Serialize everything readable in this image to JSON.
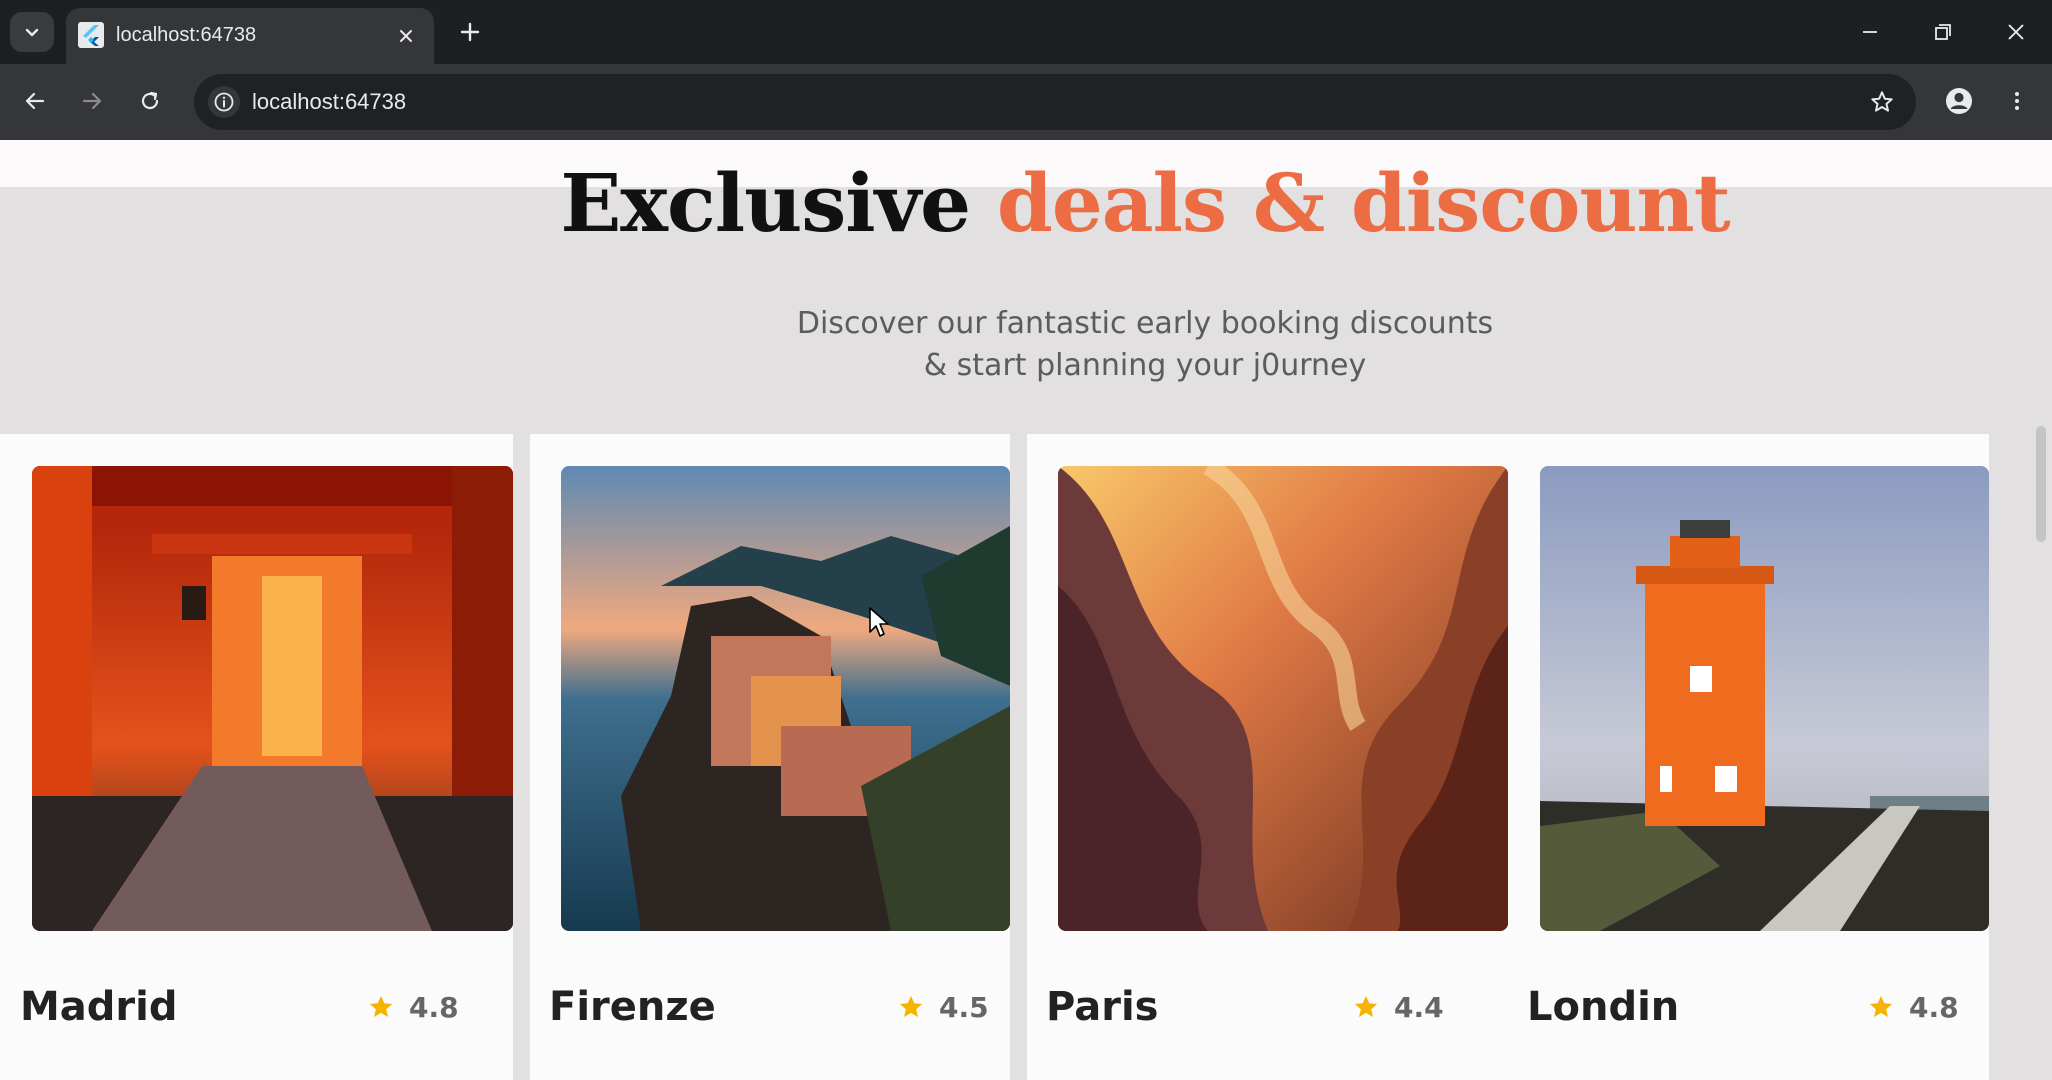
{
  "browser": {
    "tab_title": "localhost:64738",
    "url": "localhost:64738",
    "icons": {
      "tab_list": "chevron-down-icon",
      "favicon": "flutter-icon",
      "close": "close-icon",
      "new_tab": "plus-icon",
      "back": "arrow-left-icon",
      "forward": "arrow-right-icon",
      "reload": "reload-icon",
      "site_info": "info-icon",
      "bookmark": "star-outline-icon",
      "profile": "person-icon",
      "menu": "kebab-menu-icon",
      "minimize": "minimize-icon",
      "restore": "restore-icon",
      "window_close": "close-icon"
    }
  },
  "hero": {
    "title_main": "Exclusive ",
    "title_accent": "deals & discount",
    "subtitle_line1": "Discover our fantastic early booking discounts",
    "subtitle_line2": "& start planning your j0urney"
  },
  "colors": {
    "accent": "#ec6c43",
    "star": "#f4b400",
    "page_background": "#e2e0e0",
    "card_background": "#fbfbfb",
    "title_dark": "#111111",
    "subtitle_gray": "#5c5c5c"
  },
  "destinations": [
    {
      "city": "Madrid",
      "rating": "4.8",
      "image": "torii-gate-tunnel-photo"
    },
    {
      "city": "Firenze",
      "rating": "4.5",
      "image": "coastal-cliff-village-photo"
    },
    {
      "city": "Paris",
      "rating": "4.4",
      "image": "sandstone-canyon-photo"
    },
    {
      "city": "Londin",
      "rating": "4.8",
      "image": "orange-lighthouse-photo"
    }
  ]
}
